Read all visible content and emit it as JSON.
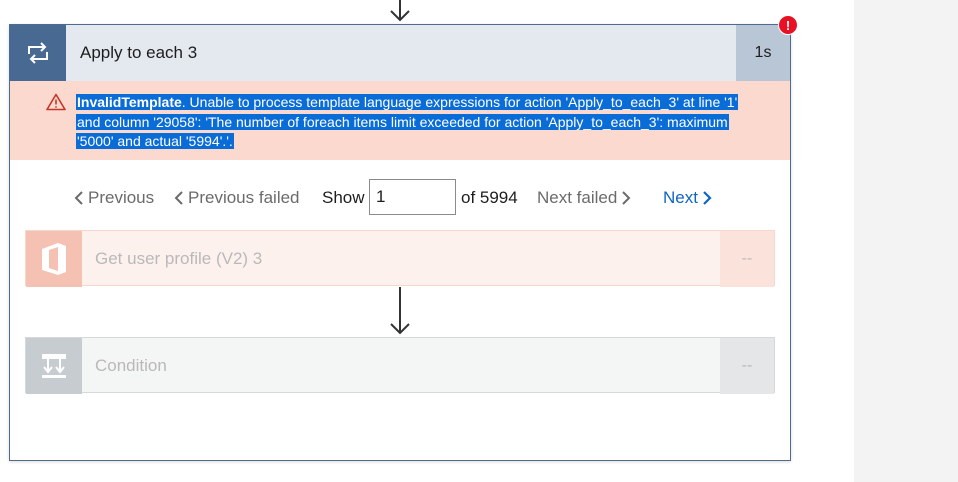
{
  "loop_card": {
    "title": "Apply to each 3",
    "duration": "1s",
    "error_badge": "!",
    "icons": {
      "loop": "loop-arrows-icon",
      "warning": "warning-triangle-icon"
    },
    "error": {
      "code": "InvalidTemplate",
      "message": ". Unable to process template language expressions for action 'Apply_to_each_3' at line '1' and column '29058': 'The number of foreach items limit exceeded for action 'Apply_to_each_3': maximum '5000' and actual '5994'.'."
    }
  },
  "pager": {
    "previous": "Previous",
    "previous_failed": "Previous failed",
    "show_label": "Show",
    "current": "1",
    "of_total": "of 5994",
    "next_failed": "Next failed",
    "next": "Next"
  },
  "actions": [
    {
      "label": "Get user profile (V2) 3",
      "duration": "--",
      "icon": "office-logo-icon"
    },
    {
      "label": "Condition",
      "duration": "--",
      "icon": "condition-icon"
    }
  ],
  "colors": {
    "card_border": "#4f6b8f",
    "header_icon_bg": "#486991",
    "error_banner_bg": "#fbd9cf",
    "selection_highlight": "#0a6cd6",
    "link_blue": "#0f66c2",
    "error_badge": "#e81123"
  }
}
